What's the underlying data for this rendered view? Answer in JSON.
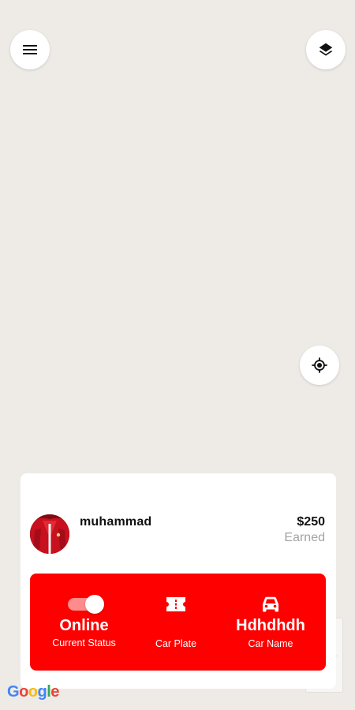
{
  "map": {
    "menu_icon": "hamburger-menu-icon",
    "layers_icon": "layers-icon",
    "locate_icon": "my-location-icon",
    "attribution": "Google"
  },
  "driver": {
    "name": "muhammad",
    "earned_amount": "$250",
    "earned_label": "Earned"
  },
  "stats": {
    "status_value": "Online",
    "status_label": "Current Status",
    "status_on": true,
    "plate_label": "Car Plate",
    "plate_icon": "ticket-icon",
    "car_value": "Hdhdhdh",
    "car_label": "Car Name",
    "car_icon": "car-icon"
  },
  "colors": {
    "accent": "#ff0000",
    "map_background": "#eeebe7",
    "toggle_track": "#ff8c8c"
  }
}
